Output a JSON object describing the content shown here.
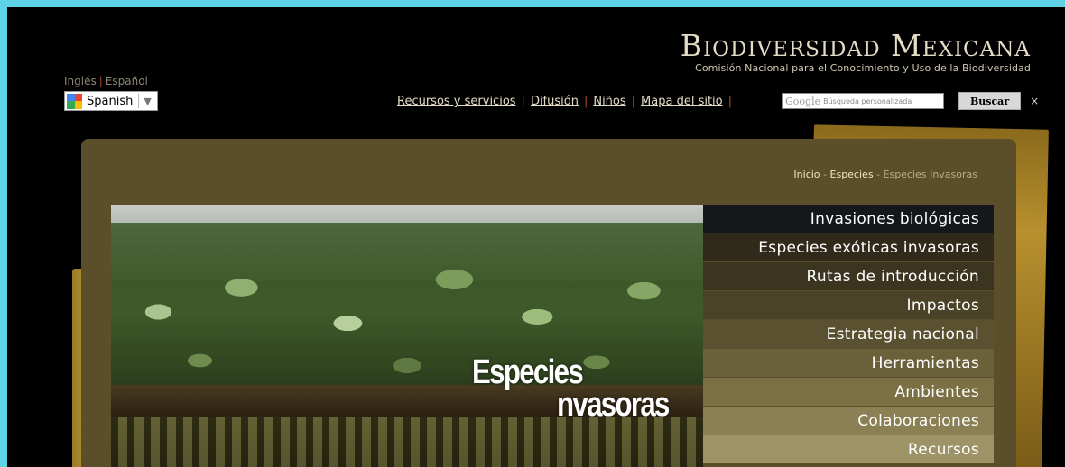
{
  "header": {
    "brand_title": "Biodiversidad Mexicana",
    "brand_subtitle": "Comisión Nacional para el Conocimiento y Uso de la Biodiversidad"
  },
  "language": {
    "english": "Inglés",
    "spanish": "Español",
    "translate_selected": "Spanish"
  },
  "nav": {
    "items": [
      "Recursos y servicios",
      "Difusión",
      "Niños",
      "Mapa del sitio"
    ],
    "trailing_sep": "|"
  },
  "search": {
    "google_logo": "Google",
    "placeholder": "Búsqueda personalizada",
    "button": "Buscar",
    "close": "×"
  },
  "breadcrumb": {
    "home": "Inicio",
    "sep": "-",
    "section": "Especies",
    "current": "Especies Invasoras"
  },
  "hero": {
    "line1": "Especies",
    "line2": "nvasoras"
  },
  "menu": {
    "items": [
      {
        "label": "Invasiones biológicas",
        "color": "#14181a"
      },
      {
        "label": "Especies exóticas invasoras",
        "color": "#2f2a1a"
      },
      {
        "label": "Rutas de introducción",
        "color": "#3b3520"
      },
      {
        "label": "Impactos",
        "color": "#4a4328"
      },
      {
        "label": "Estrategia nacional",
        "color": "#595130"
      },
      {
        "label": "Herramientas",
        "color": "#6a6039"
      },
      {
        "label": "Ambientes",
        "color": "#7a7044"
      },
      {
        "label": "Colaboraciones",
        "color": "#8b8053"
      },
      {
        "label": "Recursos",
        "color": "#9d9366"
      }
    ]
  }
}
